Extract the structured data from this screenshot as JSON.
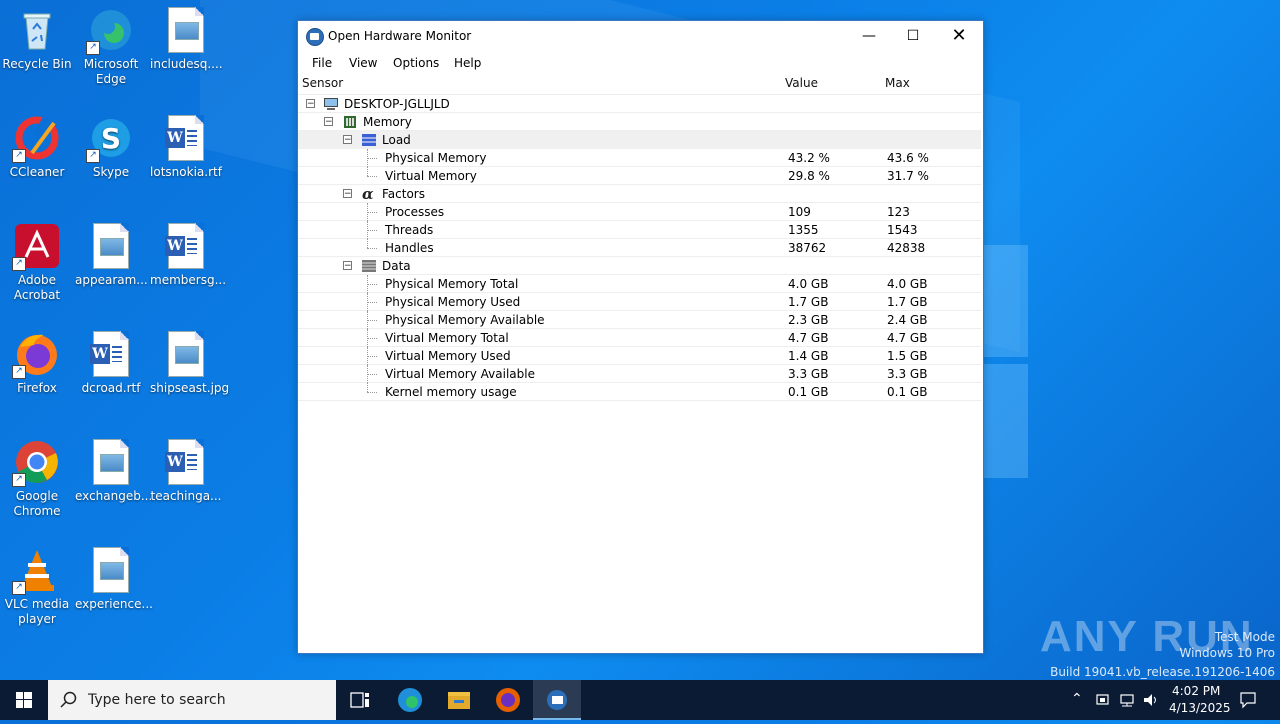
{
  "desktop": {
    "icons": [
      {
        "label": "Recycle Bin",
        "icon": "recycle-bin-icon"
      },
      {
        "label": "Microsoft Edge",
        "icon": "edge-icon"
      },
      {
        "label": "includesq....",
        "icon": "image-file-icon"
      },
      {
        "label": "CCleaner",
        "icon": "ccleaner-icon"
      },
      {
        "label": "Skype",
        "icon": "skype-icon"
      },
      {
        "label": "lotsnokia.rtf",
        "icon": "word-file-icon"
      },
      {
        "label": "Adobe Acrobat",
        "icon": "acrobat-icon"
      },
      {
        "label": "appearam...",
        "icon": "image-file-icon"
      },
      {
        "label": "membersg...",
        "icon": "word-file-icon"
      },
      {
        "label": "Firefox",
        "icon": "firefox-icon"
      },
      {
        "label": "dcroad.rtf",
        "icon": "word-file-icon"
      },
      {
        "label": "shipseast.jpg",
        "icon": "image-file-icon"
      },
      {
        "label": "Google Chrome",
        "icon": "chrome-icon"
      },
      {
        "label": "exchangeb...",
        "icon": "image-file-icon"
      },
      {
        "label": "teachinga...",
        "icon": "word-file-icon"
      },
      {
        "label": "VLC media player",
        "icon": "vlc-icon"
      },
      {
        "label": "experience...",
        "icon": "image-file-icon"
      }
    ]
  },
  "window": {
    "title": "Open Hardware Monitor",
    "menu": [
      "File",
      "View",
      "Options",
      "Help"
    ],
    "columns": {
      "sensor": "Sensor",
      "value": "Value",
      "max": "Max"
    },
    "tree": {
      "root": "DESKTOP-JGLLJLD",
      "memory": "Memory",
      "groups": [
        {
          "name": "Load",
          "rows": [
            {
              "name": "Physical Memory",
              "value": "43.2 %",
              "max": "43.6 %"
            },
            {
              "name": "Virtual Memory",
              "value": "29.8 %",
              "max": "31.7 %"
            }
          ]
        },
        {
          "name": "Factors",
          "rows": [
            {
              "name": "Processes",
              "value": "109",
              "max": "123"
            },
            {
              "name": "Threads",
              "value": "1355",
              "max": "1543"
            },
            {
              "name": "Handles",
              "value": "38762",
              "max": "42838"
            }
          ]
        },
        {
          "name": "Data",
          "rows": [
            {
              "name": "Physical Memory Total",
              "value": "4.0 GB",
              "max": "4.0 GB"
            },
            {
              "name": "Physical Memory Used",
              "value": "1.7 GB",
              "max": "1.7 GB"
            },
            {
              "name": "Physical Memory Available",
              "value": "2.3 GB",
              "max": "2.4 GB"
            },
            {
              "name": "Virtual Memory Total",
              "value": "4.7 GB",
              "max": "4.7 GB"
            },
            {
              "name": "Virtual Memory Used",
              "value": "1.4 GB",
              "max": "1.5 GB"
            },
            {
              "name": "Virtual Memory Available",
              "value": "3.3 GB",
              "max": "3.3 GB"
            },
            {
              "name": "Kernel memory usage",
              "value": "0.1 GB",
              "max": "0.1 GB"
            }
          ]
        }
      ]
    }
  },
  "watermark": {
    "brand": "ANY RUN",
    "line1": "Test Mode",
    "line2": "Windows 10 Pro",
    "line3": "Build 19041.vb_release.191206-1406"
  },
  "taskbar": {
    "search_placeholder": "Type here to search",
    "time": "4:02 PM",
    "date": "4/13/2025"
  }
}
